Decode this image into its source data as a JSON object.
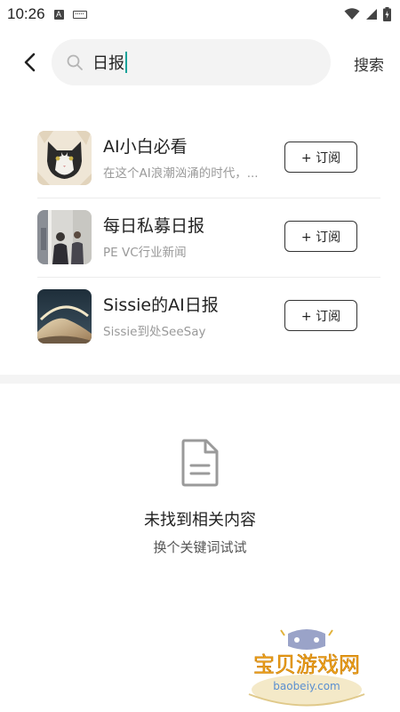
{
  "status_bar": {
    "time": "10:26",
    "notif_a": "A"
  },
  "search": {
    "value": "日报",
    "action_label": "搜索"
  },
  "results": [
    {
      "title": "AI小白必看",
      "subtitle": "在这个AI浪潮汹涌的时代，...",
      "button": "+ 订阅"
    },
    {
      "title": "每日私募日报",
      "subtitle": "PE VC行业新闻",
      "button": "+ 订阅"
    },
    {
      "title": "Sissie的AI日报",
      "subtitle": "Sissie到处SeeSay",
      "button": "+ 订阅"
    }
  ],
  "empty_state": {
    "title": "未找到相关内容",
    "subtitle": "换个关键词试试"
  },
  "watermark": {
    "text": "宝贝游戏网",
    "url": "baobeiy.com"
  },
  "colors": {
    "caret": "#1aa39a",
    "search_bg": "#f3f3f3",
    "band": "#f4f4f4"
  }
}
